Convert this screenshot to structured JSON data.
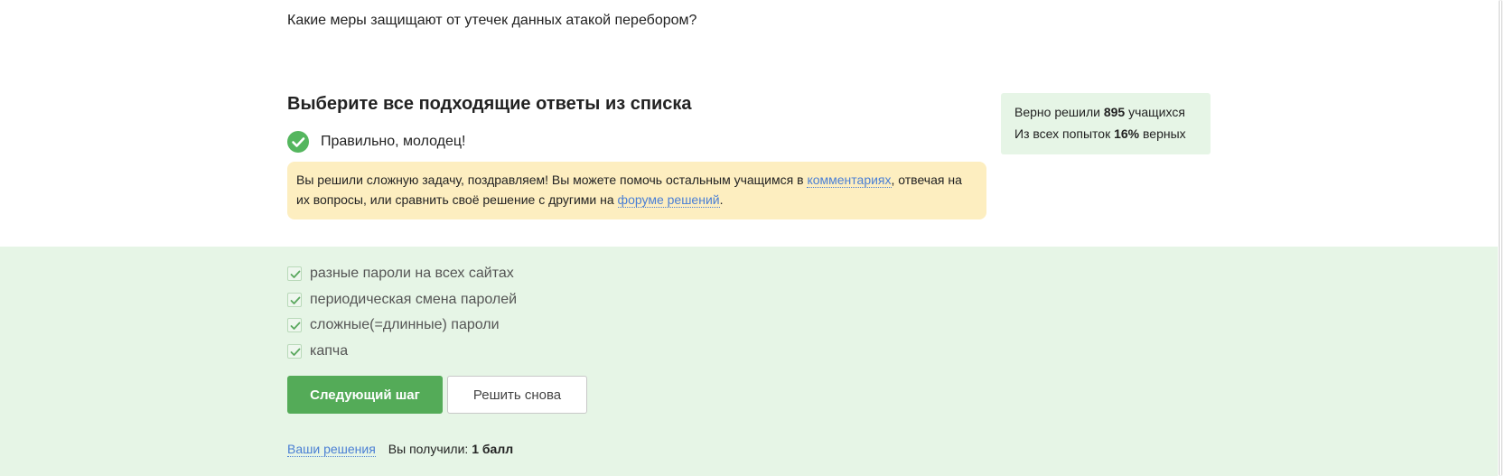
{
  "question": "Какие меры защищают от утечек данных атакой перебором?",
  "task": {
    "header": "Выберите все подходящие ответы из списка",
    "status": "Правильно, молодец!",
    "hint": {
      "part1": "Вы решили сложную задачу, поздравляем! Вы можете помочь остальным учащимся в ",
      "link1": "комментариях",
      "part2": ", отвечая на их вопросы, или сравнить своё решение с другими на ",
      "link2": "форуме решений",
      "part3": "."
    }
  },
  "stats": {
    "line1_prefix": "Верно решили ",
    "solved_count": "895",
    "line1_suffix": " учащихся",
    "line2_prefix": "Из всех попыток ",
    "percent": "16%",
    "line2_suffix": " верных"
  },
  "options": [
    {
      "label": "разные пароли на всех сайтах",
      "checked": true
    },
    {
      "label": "периодическая смена паролей",
      "checked": true
    },
    {
      "label": "сложные(=длинные) пароли",
      "checked": true
    },
    {
      "label": "капча",
      "checked": true
    }
  ],
  "buttons": {
    "next": "Следующий шаг",
    "retry": "Решить снова"
  },
  "footer": {
    "solutions_link": "Ваши решения",
    "score_prefix": "Вы получили: ",
    "score": "1 балл"
  },
  "colors": {
    "accent_green": "#54ab58",
    "success_bg": "#e6f5e6",
    "hint_bg": "#fdeec0",
    "link": "#4a7fd4"
  },
  "icons": {
    "status": "check-circle-icon",
    "option": "checkbox-checked-icon"
  }
}
